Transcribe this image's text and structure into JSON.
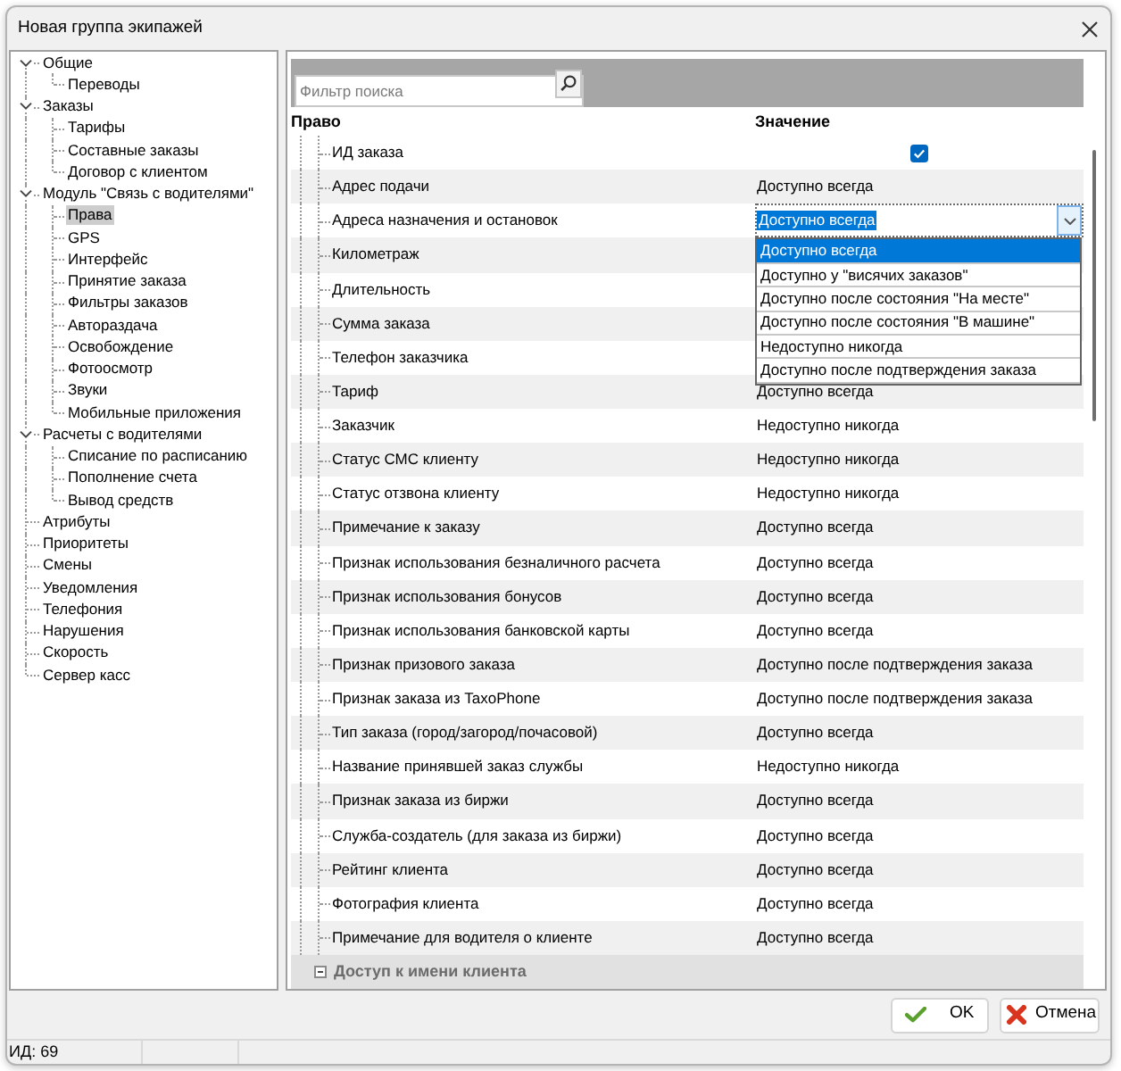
{
  "window": {
    "title": "Новая группа экипажей"
  },
  "sidebar": {
    "items": [
      {
        "label": "Общие",
        "selected": false,
        "expanded": true,
        "children": [
          {
            "label": "Переводы",
            "selected": false
          }
        ]
      },
      {
        "label": "Заказы",
        "selected": false,
        "expanded": true,
        "children": [
          {
            "label": "Тарифы",
            "selected": false
          },
          {
            "label": "Составные заказы",
            "selected": false
          },
          {
            "label": "Договор с клиентом",
            "selected": false
          }
        ]
      },
      {
        "label": "Модуль \"Связь с водителями\"",
        "selected": false,
        "expanded": true,
        "children": [
          {
            "label": "Права",
            "selected": true
          },
          {
            "label": "GPS",
            "selected": false
          },
          {
            "label": "Интерфейс",
            "selected": false
          },
          {
            "label": "Принятие заказа",
            "selected": false
          },
          {
            "label": "Фильтры заказов",
            "selected": false
          },
          {
            "label": "Автораздача",
            "selected": false
          },
          {
            "label": "Освобождение",
            "selected": false
          },
          {
            "label": "Фотоосмотр",
            "selected": false
          },
          {
            "label": "Звуки",
            "selected": false
          },
          {
            "label": "Мобильные приложения",
            "selected": false
          }
        ]
      },
      {
        "label": "Расчеты с водителями",
        "selected": false,
        "expanded": true,
        "children": [
          {
            "label": "Списание по расписанию",
            "selected": false
          },
          {
            "label": "Пополнение счета",
            "selected": false
          },
          {
            "label": "Вывод средств",
            "selected": false
          }
        ]
      },
      {
        "label": "Атрибуты",
        "selected": false
      },
      {
        "label": "Приоритеты",
        "selected": false
      },
      {
        "label": "Смены",
        "selected": false
      },
      {
        "label": "Уведомления",
        "selected": false
      },
      {
        "label": "Телефония",
        "selected": false
      },
      {
        "label": "Нарушения",
        "selected": false
      },
      {
        "label": "Скорость",
        "selected": false
      },
      {
        "label": "Сервер касс",
        "selected": false
      }
    ]
  },
  "filter": {
    "placeholder": "Фильтр поиска"
  },
  "table": {
    "columns": [
      "Право",
      "Значение"
    ],
    "rows": [
      {
        "name": "ИД заказа",
        "kind": "checkbox",
        "checked": true
      },
      {
        "name": "Адрес подачи",
        "kind": "text",
        "value": "Доступно всегда"
      },
      {
        "name": "Адреса назначения и остановок",
        "kind": "dropdown",
        "value": "Доступно всегда",
        "focused": true,
        "expanded": true,
        "options": [
          {
            "label": "Доступно всегда",
            "selected": true
          },
          {
            "label": "Доступно у \"висячих заказов\"",
            "selected": false
          },
          {
            "label": "Доступно после состояния \"На месте\"",
            "selected": false
          },
          {
            "label": "Доступно после состояния \"В машине\"",
            "selected": false
          },
          {
            "label": "Недоступно никогда",
            "selected": false
          },
          {
            "label": "Доступно после подтверждения заказа",
            "selected": false
          }
        ]
      },
      {
        "name": "Километраж",
        "kind": "text"
      },
      {
        "name": "Длительность",
        "kind": "text"
      },
      {
        "name": "Сумма заказа",
        "kind": "text"
      },
      {
        "name": "Телефон заказчика",
        "kind": "text"
      },
      {
        "name": "Тариф",
        "kind": "text",
        "value": "Доступно всегда"
      },
      {
        "name": "Заказчик",
        "kind": "text",
        "value": "Недоступно никогда"
      },
      {
        "name": "Статус СМС клиенту",
        "kind": "text",
        "value": "Недоступно никогда"
      },
      {
        "name": "Статус отзвона клиенту",
        "kind": "text",
        "value": "Недоступно никогда"
      },
      {
        "name": "Примечание к заказу",
        "kind": "text",
        "value": "Доступно всегда"
      },
      {
        "name": "Признак использования безналичного расчета",
        "kind": "text",
        "value": "Доступно всегда"
      },
      {
        "name": "Признак использования бонусов",
        "kind": "text",
        "value": "Доступно всегда"
      },
      {
        "name": "Признак использования банковской карты",
        "kind": "text",
        "value": "Доступно всегда"
      },
      {
        "name": "Признак призового заказа",
        "kind": "text",
        "value": "Доступно после подтверждения заказа"
      },
      {
        "name": "Признак заказа из TaxoPhone",
        "kind": "text",
        "value": "Доступно после подтверждения заказа"
      },
      {
        "name": "Тип заказа (город/загород/почасовой)",
        "kind": "text",
        "value": "Доступно всегда"
      },
      {
        "name": "Название принявшей заказ службы",
        "kind": "text",
        "value": "Недоступно никогда"
      },
      {
        "name": "Признак заказа из биржи",
        "kind": "text",
        "value": "Доступно всегда"
      },
      {
        "name": "Служба-создатель (для заказа из биржи)",
        "kind": "text",
        "value": "Доступно всегда"
      },
      {
        "name": "Рейтинг клиента",
        "kind": "text",
        "value": "Доступно всегда"
      },
      {
        "name": "Фотография клиента",
        "kind": "text",
        "value": "Доступно всегда"
      },
      {
        "name": "Примечание для водителя о клиенте",
        "kind": "text",
        "value": "Доступно всегда"
      }
    ],
    "group": {
      "label": "Доступ к имени клиента",
      "expanded": true
    }
  },
  "buttons": [
    {
      "label": "OK",
      "kind": "ok"
    },
    {
      "label": "Отмена",
      "kind": "cancel"
    }
  ],
  "status_bar": {
    "text": "ИД: 69"
  }
}
